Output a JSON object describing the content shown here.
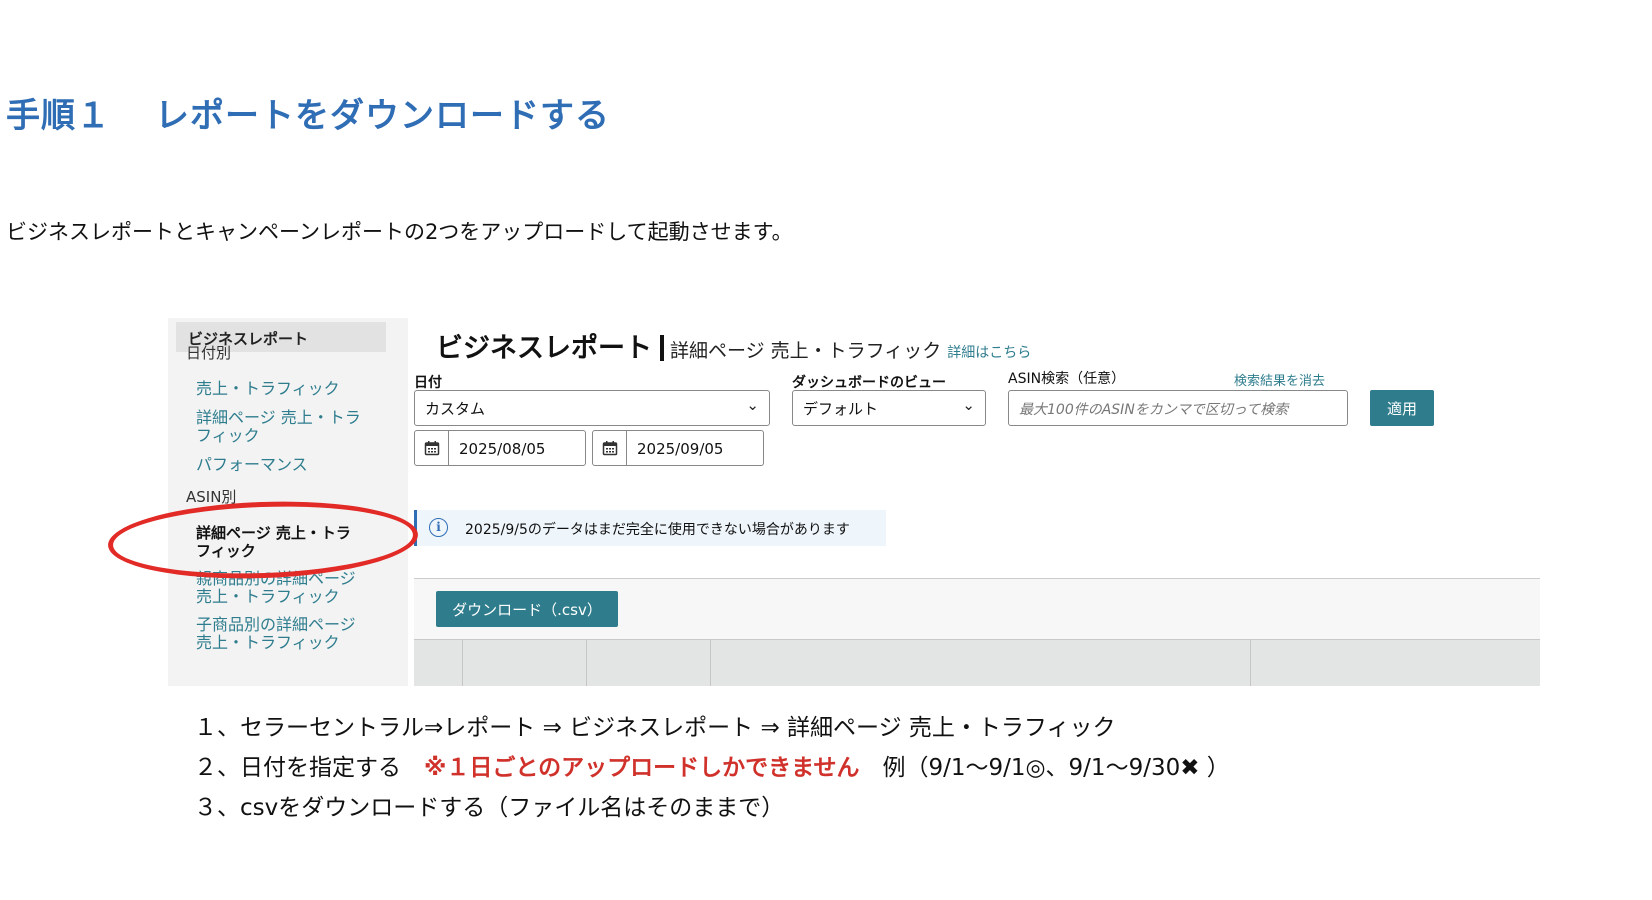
{
  "heading": {
    "step": "手順１",
    "title": "レポートをダウンロードする"
  },
  "intro": "ビジネスレポートとキャンペーンレポートの2つをアップロードして起動させます。",
  "screenshot": {
    "sidebar": {
      "header": "ビジネスレポート",
      "section_date": "日付別",
      "date_items": [
        "売上・トラフィック",
        "詳細ページ 売上・トラ\nフィック",
        "パフォーマンス"
      ],
      "section_asin": "ASIN別",
      "asin_items": [
        "詳細ページ 売上・トラ\nフィック",
        "親商品別の詳細ページ\n売上・トラフィック",
        "子商品別の詳細ページ\n売上・トラフィック"
      ]
    },
    "title": "ビジネスレポート",
    "subtitle": "詳細ページ 売上・トラフィック",
    "details_link": "詳細はこちら",
    "date_label": "日付",
    "date_select": "カスタム",
    "start_date": "2025/08/05",
    "end_date": "2025/09/05",
    "dashboard_label": "ダッシュボードのビュー",
    "dashboard_select": "デフォルト",
    "asin_label": "ASIN検索（任意）",
    "asin_placeholder": "最大100件のASINをカンマで区切って検索",
    "clear_link": "検索結果を消去",
    "apply_button": "適用",
    "notice": "2025/9/5のデータはまだ完全に使用できない場合があります",
    "download_button": "ダウンロード（.csv）"
  },
  "steps": {
    "step1": "１、セラーセントラル⇒レポート ⇒ ビジネスレポート ⇒ 詳細ページ 売上・トラフィック",
    "step2_prefix": "２、日付を指定する　",
    "step2_warning": "※１日ごとのアップロードしかできません",
    "step2_example": "　例（9/1〜9/1◎、9/1〜9/30✖︎ ）",
    "step3": "３、csvをダウンロードする（ファイル名はそのままで）"
  },
  "colors": {
    "heading": "#2f6db5",
    "accent": "#2f7d8c",
    "warning": "#d0322b",
    "circle": "#e22a26"
  },
  "icons": [
    "calendar-icon",
    "chevron-down-icon",
    "info-icon"
  ]
}
